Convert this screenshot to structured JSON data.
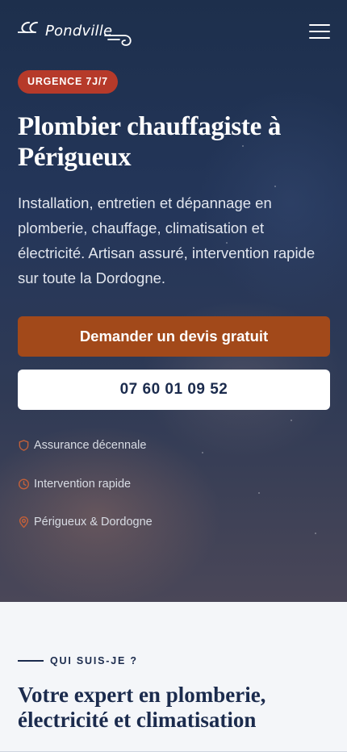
{
  "header": {
    "logo_text": "Pondville",
    "menu_icon": "hamburger-icon"
  },
  "hero": {
    "badge": "URGENCE 7J/7",
    "title": "Plombier chauffagiste à Périgueux",
    "description": "Installation, entretien et dépannage en plomberie, chauffage, climatisation et électricité. Artisan assuré, intervention rapide sur toute la Dordogne.",
    "cta_primary": "Demander un devis gratuit",
    "cta_phone": "07 60 01 09 52",
    "features": [
      {
        "icon": "shield-icon",
        "label": "Assurance décennale"
      },
      {
        "icon": "clock-icon",
        "label": "Intervention rapide"
      },
      {
        "icon": "map-pin-icon",
        "label": "Périgueux & Dordogne"
      }
    ]
  },
  "about": {
    "eyebrow": "QUI SUIS-JE ?",
    "title": "Votre expert en plomberie, électricité et climatisation"
  },
  "colors": {
    "accent": "#a2491a",
    "badge": "#b63a2a",
    "navy": "#1b2b4d",
    "feature_icon": "#c2603a"
  }
}
